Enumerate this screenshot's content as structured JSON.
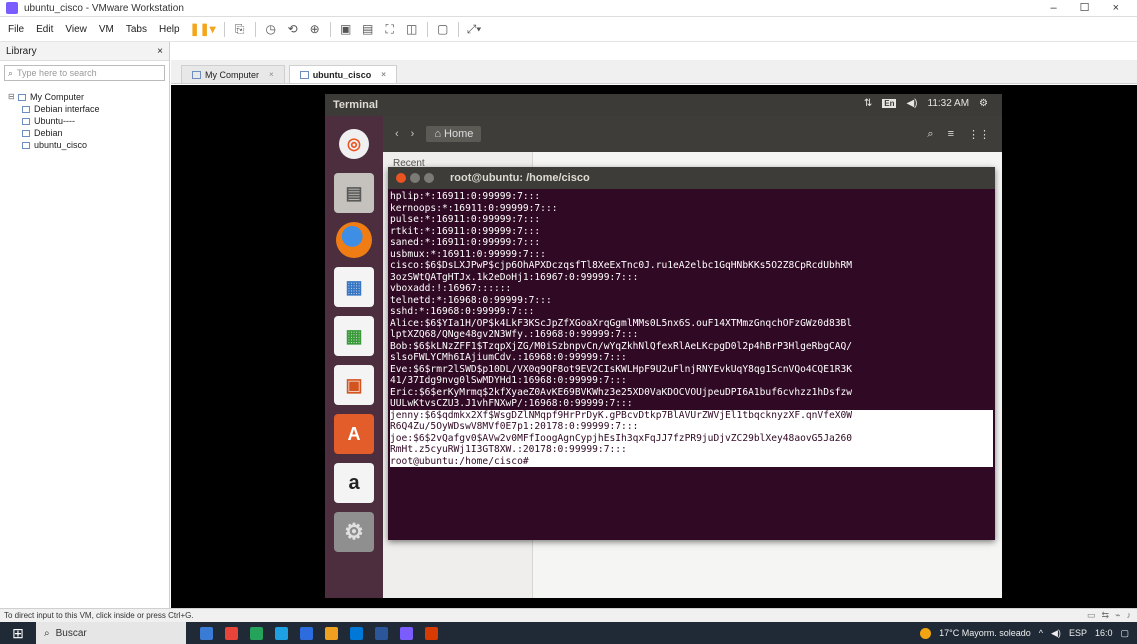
{
  "window": {
    "title": "ubuntu_cisco - VMware Workstation",
    "controls": "– ☐ ×"
  },
  "menu": {
    "items": [
      "File",
      "Edit",
      "View",
      "VM",
      "Tabs",
      "Help"
    ]
  },
  "library": {
    "title": "Library",
    "close": "×",
    "search_placeholder": "Type here to search",
    "tree_root": "My Computer",
    "tree_items": [
      "Debian interface",
      "Ubuntu----",
      "Debian",
      "ubuntu_cisco"
    ]
  },
  "tabs": [
    {
      "label": "My Computer",
      "active": false
    },
    {
      "label": "ubuntu_cisco",
      "active": true
    }
  ],
  "ubuntu": {
    "panel_title": "Terminal",
    "clock": "11:32 AM",
    "keyboard": "En",
    "file_manager_location": "Home",
    "file_manager_sidebar": [
      "Recent"
    ]
  },
  "terminal": {
    "title": "root@ubuntu: /home/cisco",
    "lines": [
      {
        "text": "hplip:*:16911:0:99999:7:::",
        "selected": false
      },
      {
        "text": "kernoops:*:16911:0:99999:7:::",
        "selected": false
      },
      {
        "text": "pulse:*:16911:0:99999:7:::",
        "selected": false
      },
      {
        "text": "rtkit:*:16911:0:99999:7:::",
        "selected": false
      },
      {
        "text": "saned:*:16911:0:99999:7:::",
        "selected": false
      },
      {
        "text": "usbmux:*:16911:0:99999:7:::",
        "selected": false
      },
      {
        "text": "cisco:$6$DsLXJPwP$cjp6OhAPXDczqsfTl8XeExTnc0J.ru1eA2elbc1GqHNbKKs5O2Z8CpRcdUbhRM",
        "selected": false
      },
      {
        "text": "3ozSWtQATgHTJx.1k2eDoHj1:16967:0:99999:7:::",
        "selected": false
      },
      {
        "text": "vboxadd:!:16967::::::",
        "selected": false
      },
      {
        "text": "telnetd:*:16968:0:99999:7:::",
        "selected": false
      },
      {
        "text": "sshd:*:16968:0:99999:7:::",
        "selected": false
      },
      {
        "text": "Alice:$6$YIa1H/OP$k4LkF3KScJpZfXGoaXrqGgmlMMs0L5nx6S.ouF14XTMmzGnqchOFzGWz0d83Bl",
        "selected": false
      },
      {
        "text": "lptXZQ68/QNge48gv2N3Wfy.:16968:0:99999:7:::",
        "selected": false
      },
      {
        "text": "Bob:$6$kLNzZFF1$TzqpXjZG/M0iSzbnpvCn/wYqZkhNlQfexRlAeLKcpgD0l2p4hBrP3HlgeRbgCAQ/",
        "selected": false
      },
      {
        "text": "slsoFWLYCMh6IAjiumCdv.:16968:0:99999:7:::",
        "selected": false
      },
      {
        "text": "Eve:$6$rmr2lSWD$p10DL/VX0q9QF8ot9EV2CIsKWLHpF9U2uFlnjRNYEvkUqY8qg1ScnVQo4CQE1R3K",
        "selected": false
      },
      {
        "text": "41/37Idg9nvg0lSwMDYHd1:16968:0:99999:7:::",
        "selected": false
      },
      {
        "text": "Eric:$6$erKyMrmq$2kfXyaeZ0AvKE69BVKWhz3e25XD0VaKDOCVOUjpeuDPI6A1buf6cvhzz1hDsfzw",
        "selected": false
      },
      {
        "text": "UULwKtvsCZU3.J1vhFNXwP/:16968:0:99999:7:::",
        "selected": false
      },
      {
        "text": "jenny:$6$qdmkx2Xf$WsgDZlNMqpf9HrPrDyK.gPBcvDtkp7BlAVUrZWVjEl1tbqcknyzXF.qnVfeX0W",
        "selected": true
      },
      {
        "text": "R6Q4Zu/5OyWDswV8MVf0E7p1:20178:0:99999:7:::",
        "selected": true
      },
      {
        "text": "joe:$6$2vQafgv0$AVw2v0MFfIoogAgnCypjhEsIh3qxFqJJ7fzPR9juDjvZC29blXey48aovG5Ja260",
        "selected": true
      },
      {
        "text": "RmHt.z5cyuRWj1I3GT8XW.:20178:0:99999:7:::",
        "selected": true
      },
      {
        "text": "root@ubuntu:/home/cisco#",
        "selected": true,
        "cursor": true
      }
    ]
  },
  "statusbar": {
    "text": "To direct input to this VM, click inside or press Ctrl+G."
  },
  "taskbar": {
    "search_placeholder": "Buscar",
    "weather": "17°C Mayorm. soleado",
    "lang": "ESP",
    "time": "16:0"
  },
  "colors": {
    "terminal_bg": "#300a24",
    "ubuntu_launcher": "#4c2e3f",
    "ubuntu_panel": "#3c3b37",
    "accent": "#e95420"
  }
}
